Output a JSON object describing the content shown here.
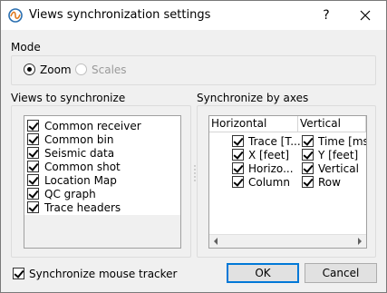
{
  "window": {
    "title": "Views synchronization settings",
    "help_label": "?",
    "app_icon": "app-logo-icon",
    "close_icon": "close-icon"
  },
  "mode": {
    "label": "Mode",
    "options": [
      {
        "label": "Zoom",
        "selected": true,
        "enabled": true
      },
      {
        "label": "Scales",
        "selected": false,
        "enabled": false
      }
    ]
  },
  "views": {
    "label": "Views to synchronize",
    "items": [
      {
        "label": "Common receiver",
        "checked": true
      },
      {
        "label": "Common bin",
        "checked": true
      },
      {
        "label": "Seismic data",
        "checked": true
      },
      {
        "label": "Common shot",
        "checked": true
      },
      {
        "label": "Location Map",
        "checked": true
      },
      {
        "label": "QC graph",
        "checked": true
      },
      {
        "label": "Trace headers",
        "checked": true
      }
    ]
  },
  "axes": {
    "label": "Synchronize by axes",
    "columns": [
      "Horizontal",
      "Vertical"
    ],
    "rows": [
      {
        "horizontal": "Trace [T...",
        "vertical": "Time [ms]"
      },
      {
        "horizontal": "X [feet]",
        "vertical": "Y [feet]"
      },
      {
        "horizontal": "Horizo...",
        "vertical": "Vertical"
      },
      {
        "horizontal": "Column",
        "vertical": "Row"
      }
    ]
  },
  "footer": {
    "mouse_tracker_label": "Synchronize mouse tracker",
    "mouse_tracker_checked": true,
    "ok_label": "OK",
    "cancel_label": "Cancel"
  },
  "colors": {
    "accent": "#0078d7",
    "window_bg": "#f0f0f0",
    "titlebar_bg": "#ffffff"
  }
}
